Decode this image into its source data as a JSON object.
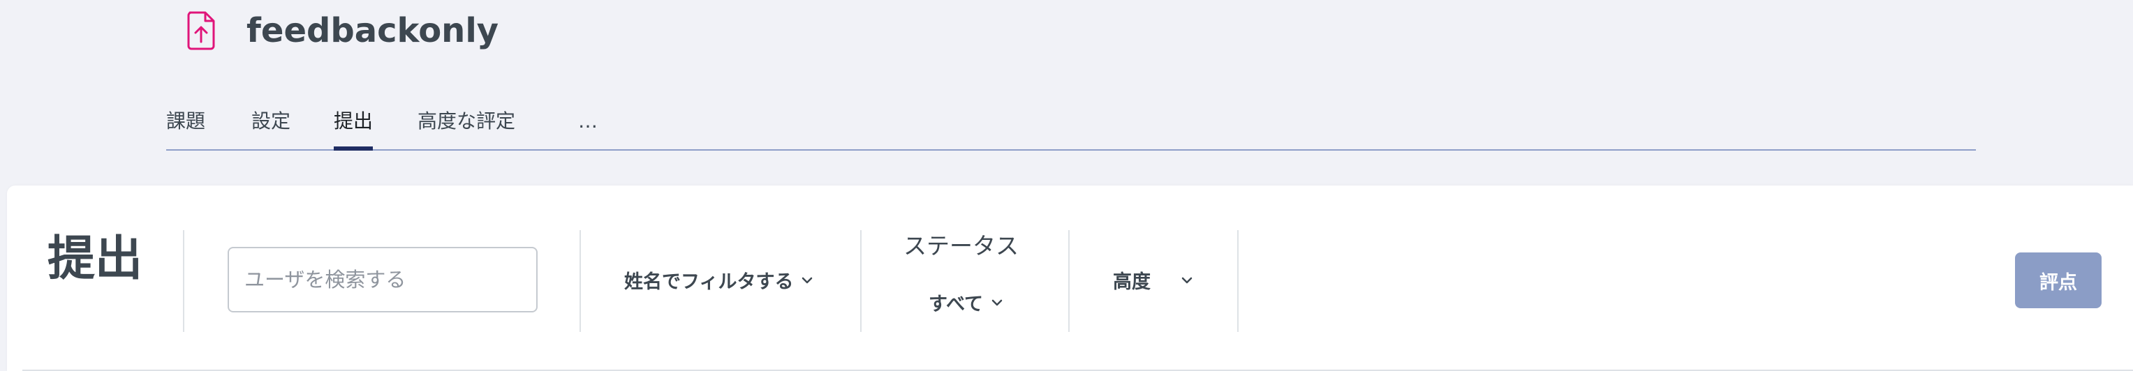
{
  "header": {
    "icon": "file-upload-icon",
    "icon_color": "#e0157a",
    "title": "feedbackonly"
  },
  "nav": {
    "items": [
      {
        "label": "課題"
      },
      {
        "label": "設定"
      },
      {
        "label": "提出",
        "active": true
      },
      {
        "label": "高度な評定"
      },
      {
        "label": "…"
      }
    ],
    "active_color": "#1f2d63"
  },
  "submissions": {
    "title": "提出",
    "search": {
      "placeholder": "ユーザを検索する",
      "value": ""
    },
    "name_filter": {
      "label": "姓名でフィルタする"
    },
    "status": {
      "label": "ステータス",
      "selected": "すべて"
    },
    "advanced": {
      "label": "高度"
    },
    "grade_button": {
      "label": "評点",
      "color": "#8b9dc6"
    }
  }
}
